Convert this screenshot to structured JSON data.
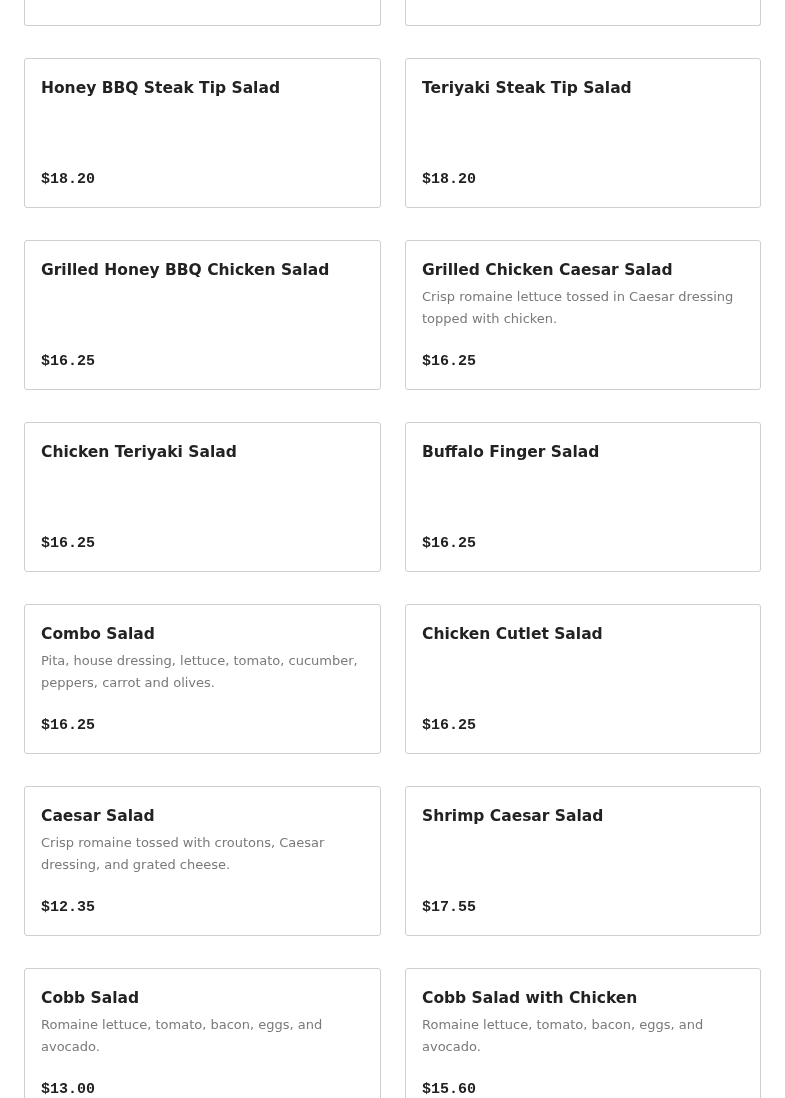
{
  "items": [
    {
      "name": "Honey BBQ Steak Tip Salad",
      "price": "$18.20"
    },
    {
      "name": "Teriyaki Steak Tip Salad",
      "price": "$18.20"
    },
    {
      "name": "Grilled Honey BBQ Chicken Salad",
      "price": "$16.25"
    },
    {
      "name": "Grilled Chicken Caesar Salad",
      "description": "Crisp romaine lettuce tossed in Caesar dressing topped with chicken.",
      "price": "$16.25"
    },
    {
      "name": "Chicken Teriyaki Salad",
      "price": "$16.25"
    },
    {
      "name": "Buffalo Finger Salad",
      "price": "$16.25"
    },
    {
      "name": "Combo Salad",
      "description": "Pita, house dressing, lettuce, tomato, cucumber, peppers, carrot and olives.",
      "price": "$16.25"
    },
    {
      "name": "Chicken Cutlet Salad",
      "price": "$16.25"
    },
    {
      "name": "Caesar Salad",
      "description": "Crisp romaine tossed with croutons, Caesar dressing, and grated cheese.",
      "price": "$12.35"
    },
    {
      "name": "Shrimp Caesar Salad",
      "price": "$17.55"
    },
    {
      "name": "Cobb Salad",
      "description": "Romaine lettuce, tomato, bacon, eggs, and avocado.",
      "price": "$13.00"
    },
    {
      "name": "Cobb Salad with Chicken",
      "description": "Romaine lettuce, tomato, bacon, eggs, and avocado.",
      "price": "$15.60"
    }
  ]
}
